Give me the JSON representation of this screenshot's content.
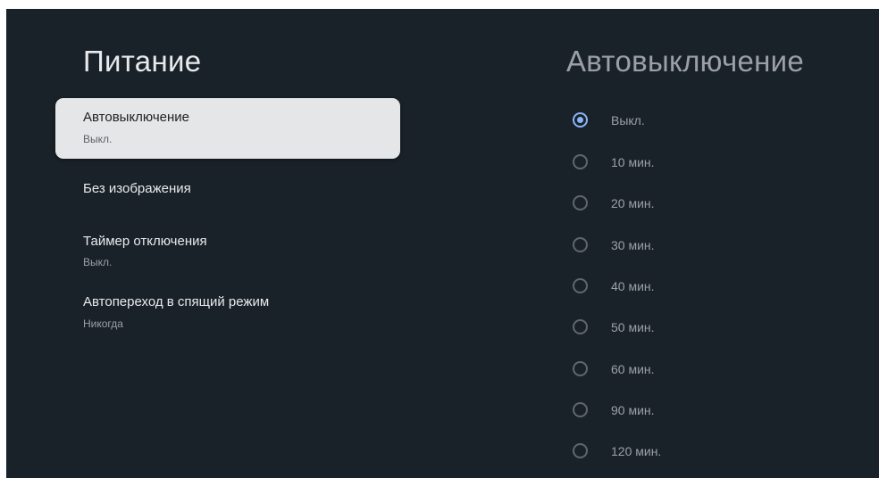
{
  "left_panel": {
    "title": "Питание",
    "items": [
      {
        "label": "Автовыключение",
        "value": "Выкл."
      },
      {
        "label": "Без изображения"
      },
      {
        "label": "Таймер отключения",
        "value": "Выкл."
      },
      {
        "label": "Автопереход в спящий режим",
        "value": "Никогда"
      }
    ]
  },
  "right_panel": {
    "title": "Автовыключение",
    "selected": "Выкл.",
    "options": [
      "Выкл.",
      "10 мин.",
      "20 мин.",
      "30 мин.",
      "40 мин.",
      "50 мин.",
      "60 мин.",
      "90 мин.",
      "120 мин."
    ]
  },
  "colors": {
    "background": "#1a2229",
    "selected_item_bg": "#e4e6e7",
    "radio_accent": "#8ab4f8"
  }
}
